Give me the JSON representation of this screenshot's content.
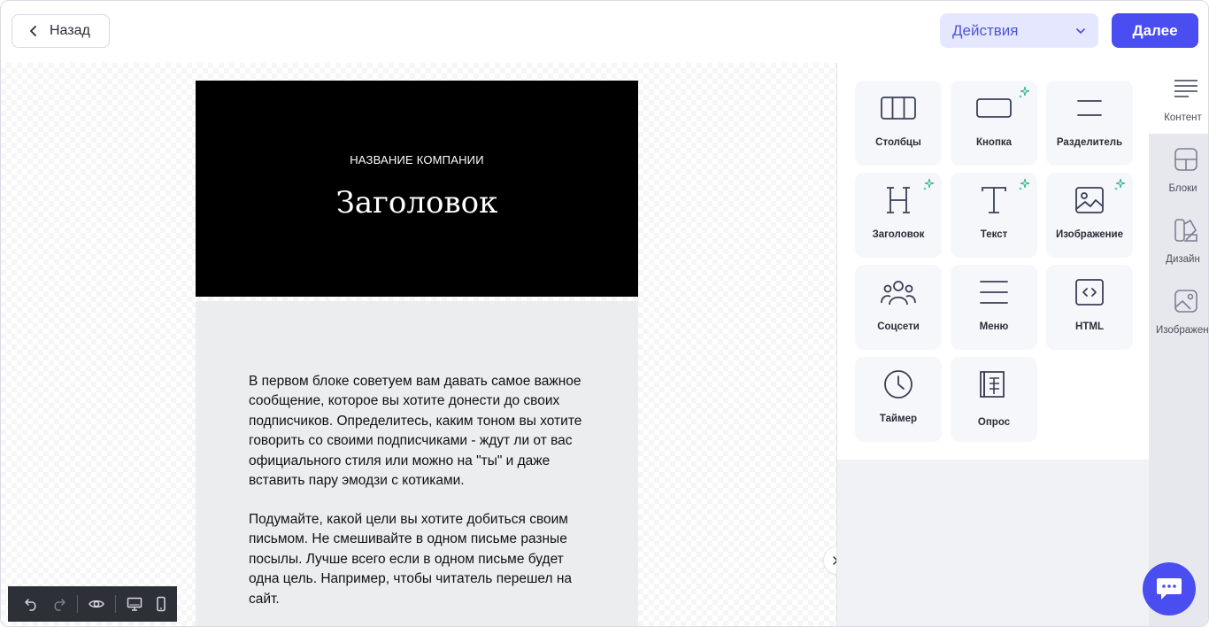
{
  "header": {
    "back_label": "Назад",
    "actions_label": "Действия",
    "next_label": "Далее"
  },
  "email": {
    "company_name": "НАЗВАНИЕ КОМПАНИИ",
    "title": "Заголовок",
    "paragraph1": "В первом блоке советуем вам давать самое важное сообщение, которое вы  хотите донести до своих подписчиков. Определитесь, каким тоном вы хотите говорить со своими подписчиками - ждут ли от вас официального стиля или можно на \"ты\" и даже вставить пару эмодзи с котиками.",
    "paragraph2": "Подумайте, какой цели вы хотите добиться своим письмом. Не смешивайте в одном письме разные посылы. Лучше всего если в одном письме будет одна цель. Например, чтобы читатель перешел на сайт."
  },
  "colors": {
    "accent": "#4a4df0",
    "accent_soft": "#e4e7ff",
    "spark": "#2fb38a"
  },
  "content_blocks": [
    {
      "label": "Столбцы",
      "icon": "columns-icon"
    },
    {
      "label": "Кнопка",
      "icon": "button-icon"
    },
    {
      "label": "Разделитель",
      "icon": "divider-icon"
    },
    {
      "label": "Заголовок",
      "icon": "heading-icon"
    },
    {
      "label": "Текст",
      "icon": "text-icon"
    },
    {
      "label": "Изображение",
      "icon": "image-icon"
    },
    {
      "label": "Соцсети",
      "icon": "social-icon"
    },
    {
      "label": "Меню",
      "icon": "menu-icon"
    },
    {
      "label": "HTML",
      "icon": "html-icon"
    },
    {
      "label": "Таймер",
      "icon": "timer-icon"
    },
    {
      "label": "Опрос",
      "icon": "poll-icon"
    }
  ],
  "sidebar": {
    "items": [
      {
        "label": "Контент",
        "icon": "content-icon"
      },
      {
        "label": "Блоки",
        "icon": "blocks-icon"
      },
      {
        "label": "Дизайн",
        "icon": "design-icon"
      },
      {
        "label": "Изображения",
        "icon": "images-icon"
      }
    ]
  }
}
